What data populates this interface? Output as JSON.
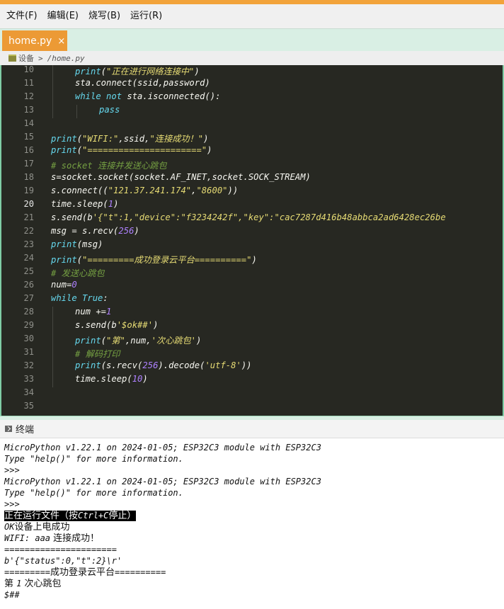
{
  "menu": [
    "文件(F)",
    "编辑(E)",
    "烧写(B)",
    "运行(R)"
  ],
  "tab": {
    "label": "home.py",
    "close": "×"
  },
  "breadcrumb": {
    "root": "设备",
    "sep": ">",
    "path": "/home.py"
  },
  "editor": {
    "current_line": "20",
    "lines": [
      {
        "n": "10",
        "i": 1,
        "tokens": [
          [
            "kw",
            "print"
          ],
          [
            "",
            "("
          ],
          [
            "st",
            "\"正在进行网络连接中\""
          ],
          [
            "",
            ")"
          ]
        ]
      },
      {
        "n": "11",
        "i": 1,
        "tokens": [
          [
            "",
            "sta.connect(ssid,password)"
          ]
        ]
      },
      {
        "n": "12",
        "i": 1,
        "tokens": [
          [
            "kw",
            "while"
          ],
          [
            "",
            " "
          ],
          [
            "kw",
            "not"
          ],
          [
            "",
            " sta.isconnected():"
          ]
        ]
      },
      {
        "n": "13",
        "i": 2,
        "tokens": [
          [
            "kw",
            "pass"
          ]
        ]
      },
      {
        "n": "14",
        "i": 0,
        "tokens": []
      },
      {
        "n": "15",
        "i": 0,
        "tokens": [
          [
            "kw",
            "print"
          ],
          [
            "",
            "("
          ],
          [
            "st",
            "\"WIFI:\""
          ],
          [
            "",
            ",ssid,"
          ],
          [
            "st",
            "\"连接成功！\""
          ],
          [
            "",
            ")"
          ]
        ]
      },
      {
        "n": "16",
        "i": 0,
        "tokens": [
          [
            "kw",
            "print"
          ],
          [
            "",
            "("
          ],
          [
            "st",
            "\"======================\""
          ],
          [
            "",
            ")"
          ]
        ]
      },
      {
        "n": "17",
        "i": 0,
        "tokens": [
          [
            "cm",
            "# socket 连接并发送心跳包"
          ]
        ]
      },
      {
        "n": "18",
        "i": 0,
        "tokens": [
          [
            "",
            "s=socket.socket(socket.AF_INET,socket.SOCK_STREAM)"
          ]
        ]
      },
      {
        "n": "19",
        "i": 0,
        "tokens": [
          [
            "",
            "s.connect(("
          ],
          [
            "st",
            "\"121.37.241.174\""
          ],
          [
            "",
            ","
          ],
          [
            "st",
            "\"8600\""
          ],
          [
            "",
            "))"
          ]
        ]
      },
      {
        "n": "20",
        "i": 0,
        "tokens": [
          [
            "",
            "time.sleep("
          ],
          [
            "nu",
            "1"
          ],
          [
            "",
            ")"
          ]
        ]
      },
      {
        "n": "21",
        "i": 0,
        "tokens": [
          [
            "",
            "s.send(b"
          ],
          [
            "st",
            "'{\"t\":1,\"device\":\"f3234242f\",\"key\":\"cac7287d416b48abbca2ad6428ec26be"
          ]
        ]
      },
      {
        "n": "22",
        "i": 0,
        "tokens": [
          [
            "",
            "msg = s.recv("
          ],
          [
            "nu",
            "256"
          ],
          [
            "",
            ")"
          ]
        ]
      },
      {
        "n": "23",
        "i": 0,
        "tokens": [
          [
            "kw",
            "print"
          ],
          [
            "",
            "(msg)"
          ]
        ]
      },
      {
        "n": "24",
        "i": 0,
        "tokens": [
          [
            "kw",
            "print"
          ],
          [
            "",
            "("
          ],
          [
            "st",
            "\"=========成功登录云平台==========\""
          ],
          [
            "",
            ")"
          ]
        ]
      },
      {
        "n": "25",
        "i": 0,
        "tokens": [
          [
            "cm",
            "# 发送心跳包"
          ]
        ]
      },
      {
        "n": "26",
        "i": 0,
        "tokens": [
          [
            "",
            "num="
          ],
          [
            "nu",
            "0"
          ]
        ]
      },
      {
        "n": "27",
        "i": 0,
        "tokens": [
          [
            "kw",
            "while"
          ],
          [
            "",
            " "
          ],
          [
            "kw",
            "True"
          ],
          [
            "",
            ":"
          ]
        ]
      },
      {
        "n": "28",
        "i": 1,
        "tokens": [
          [
            "",
            "num +="
          ],
          [
            "nu",
            "1"
          ]
        ]
      },
      {
        "n": "29",
        "i": 1,
        "tokens": [
          [
            "",
            "s.send(b"
          ],
          [
            "st",
            "'$ok##'"
          ],
          [
            "",
            ")"
          ]
        ]
      },
      {
        "n": "30",
        "i": 1,
        "tokens": [
          [
            "kw",
            "print"
          ],
          [
            "",
            "("
          ],
          [
            "st",
            "\"第\""
          ],
          [
            "",
            ",num,"
          ],
          [
            "st",
            "'次心跳包'"
          ],
          [
            "",
            ")"
          ]
        ]
      },
      {
        "n": "31",
        "i": 1,
        "tokens": [
          [
            "cm",
            "# 解码打印"
          ]
        ]
      },
      {
        "n": "32",
        "i": 1,
        "tokens": [
          [
            "kw",
            "print"
          ],
          [
            "",
            "(s.recv("
          ],
          [
            "nu",
            "256"
          ],
          [
            "",
            ").decode("
          ],
          [
            "st",
            "'utf-8'"
          ],
          [
            "",
            "))"
          ]
        ]
      },
      {
        "n": "33",
        "i": 1,
        "tokens": [
          [
            "",
            "time.sleep("
          ],
          [
            "nu",
            "10"
          ],
          [
            "",
            ")"
          ]
        ]
      },
      {
        "n": "34",
        "i": 0,
        "tokens": []
      },
      {
        "n": "35",
        "i": 0,
        "tokens": []
      }
    ]
  },
  "terminal": {
    "title": "终端",
    "lines": [
      {
        "text": "MicroPython v1.22.1 on 2024-01-05; ESP32C3 module with ESP32C3"
      },
      {
        "text": "Type \"help()\" for more information."
      },
      {
        "text": ">>>"
      },
      {
        "text": "MicroPython v1.22.1 on 2024-01-05; ESP32C3 module with ESP32C3"
      },
      {
        "text": "Type \"help()\" for more information."
      },
      {
        "text": ">>>"
      },
      {
        "hl": true,
        "parts": [
          [
            "",
            "正在运行文件（按"
          ],
          [
            "m",
            "Ctrl+C"
          ],
          [
            "",
            "停止）"
          ]
        ]
      },
      {
        "cn": true,
        "parts": [
          [
            "m",
            "OK"
          ],
          [
            "",
            "设备上电成功"
          ]
        ]
      },
      {
        "cn": true,
        "parts": [
          [
            "m",
            "WIFI: aaa"
          ],
          [
            "",
            " 连接成功！"
          ]
        ]
      },
      {
        "text": "======================"
      },
      {
        "text": "b'{\"status\":0,\"t\":2}\\r'"
      },
      {
        "cn": true,
        "parts": [
          [
            "m",
            "========="
          ],
          [
            "",
            "成功登录云平台"
          ],
          [
            "m",
            "=========="
          ]
        ]
      },
      {
        "cn": true,
        "parts": [
          [
            "",
            "第 "
          ],
          [
            "m",
            "1"
          ],
          [
            "",
            " 次心跳包"
          ]
        ]
      },
      {
        "text": "$##"
      }
    ]
  }
}
